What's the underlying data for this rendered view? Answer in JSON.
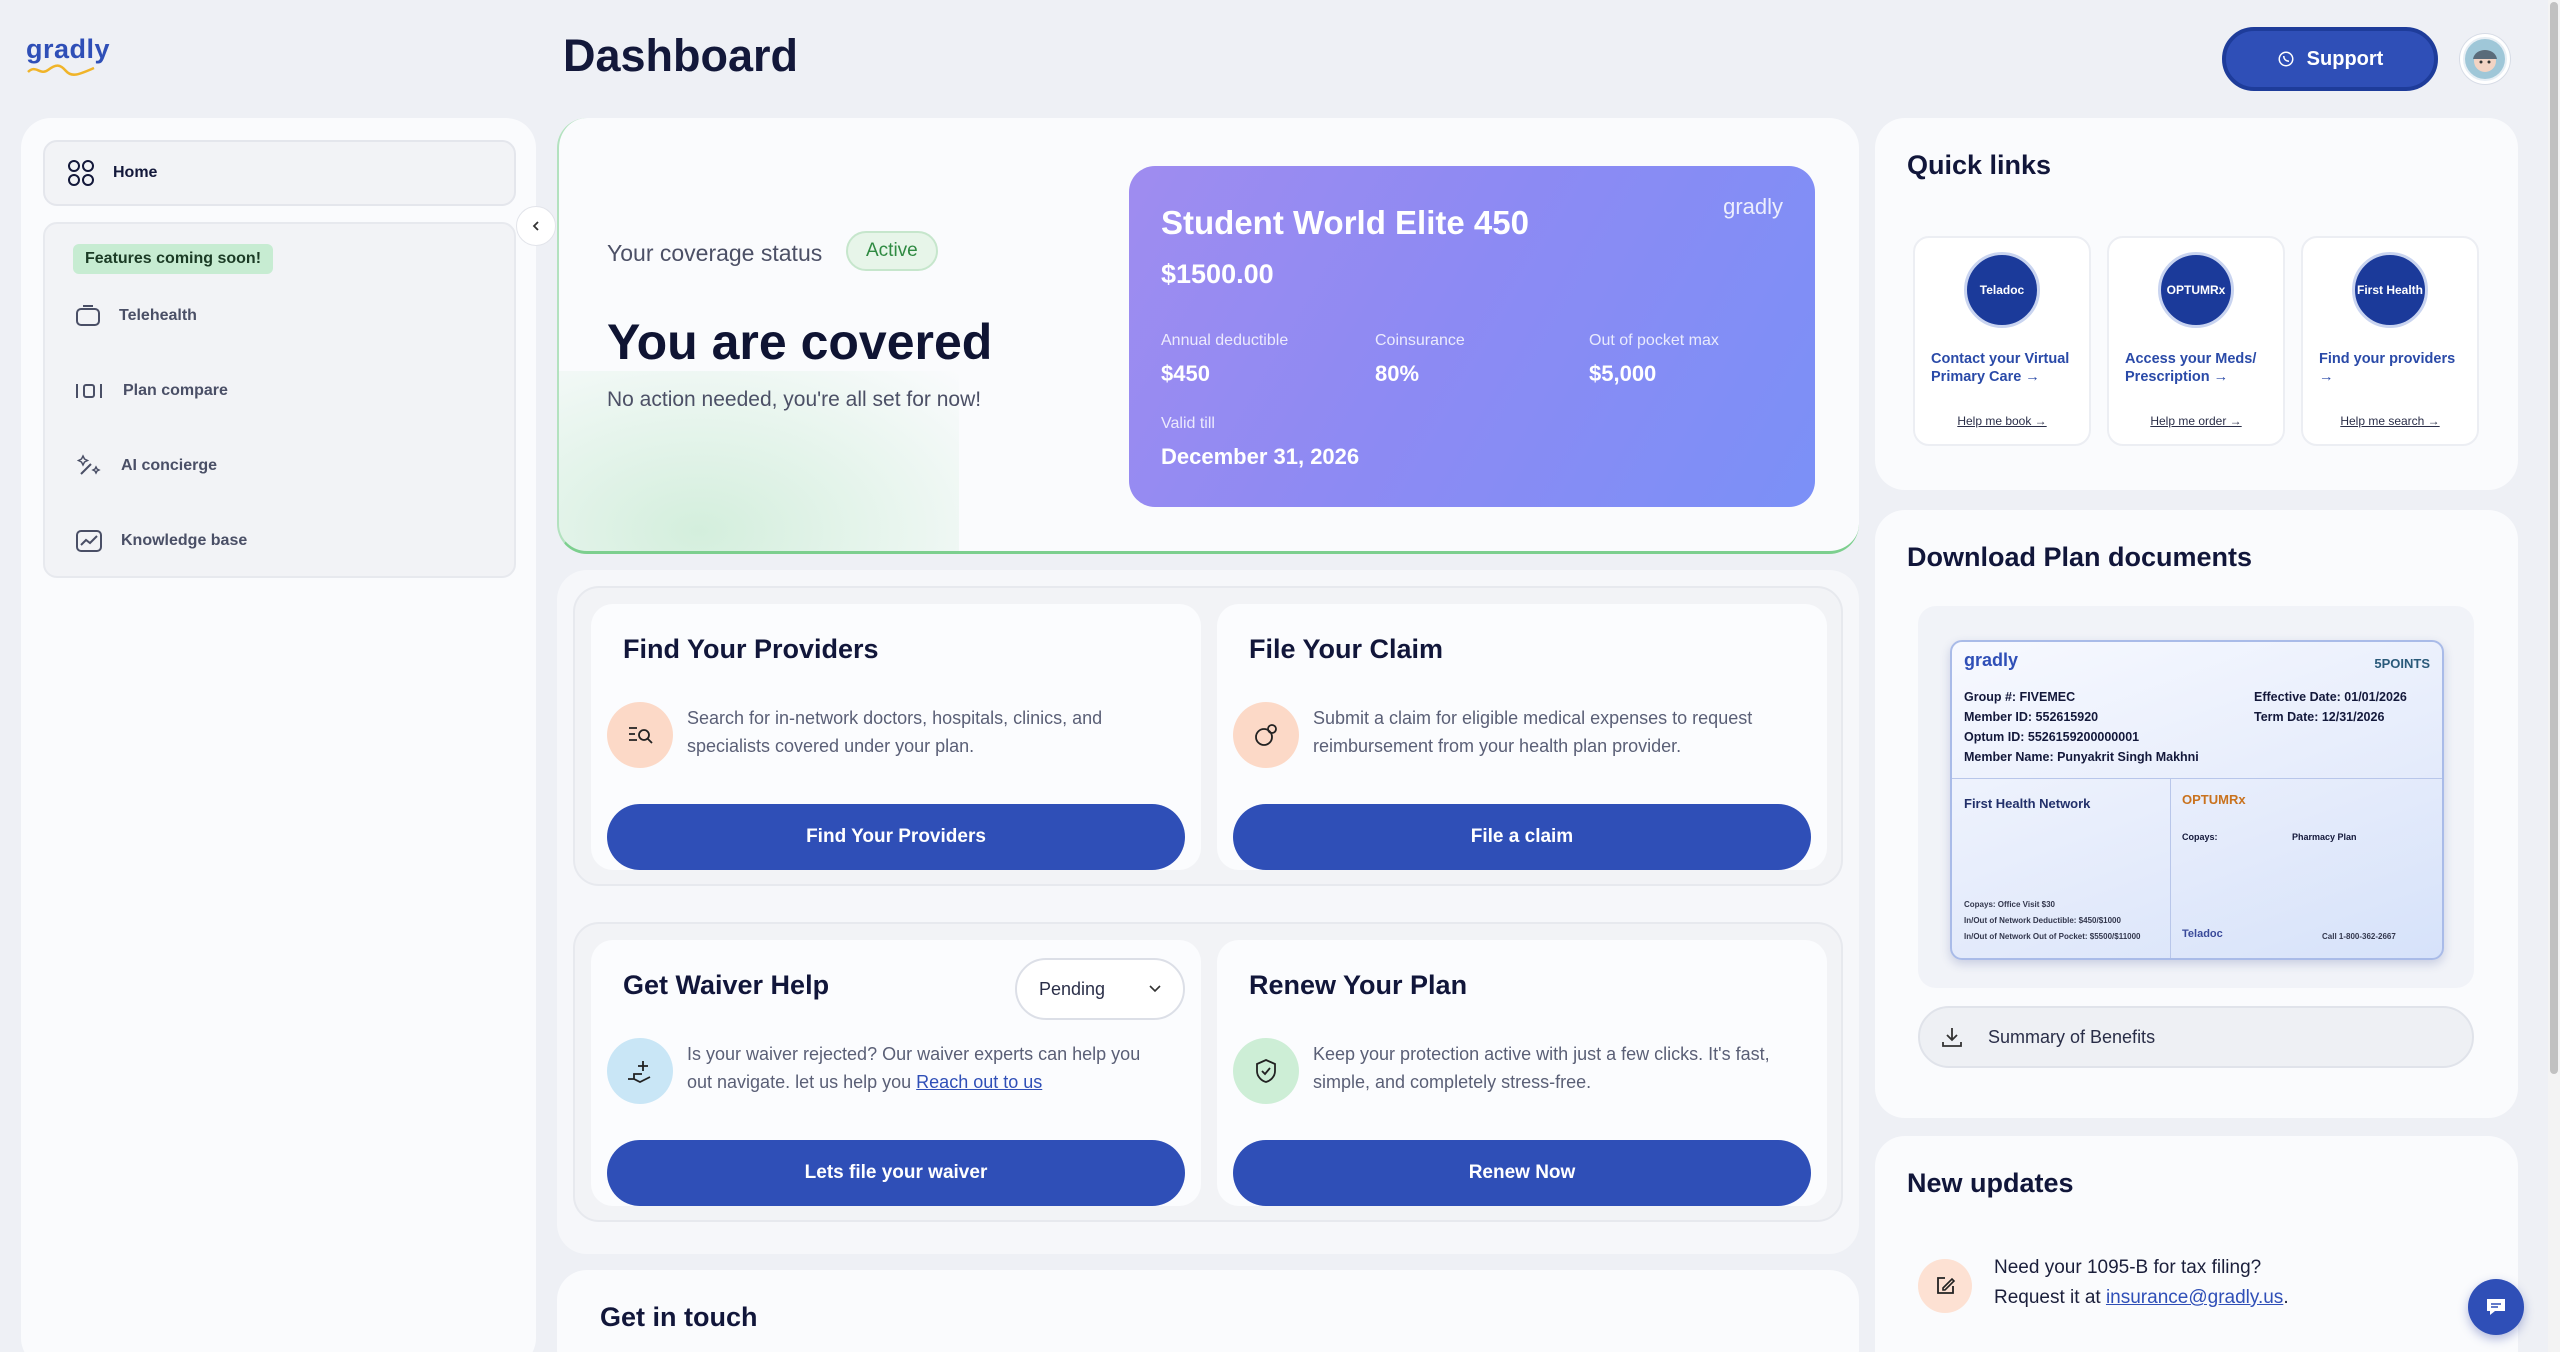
{
  "app": {
    "logo": "gradly",
    "title": "Dashboard"
  },
  "header": {
    "support_label": "Support"
  },
  "sidebar": {
    "home_label": "Home",
    "soon_badge": "Features coming soon!",
    "items": [
      {
        "label": "Telehealth",
        "icon": "tv-icon"
      },
      {
        "label": "Plan compare",
        "icon": "compare-icon"
      },
      {
        "label": "AI concierge",
        "icon": "sparkle-icon"
      },
      {
        "label": "Knowledge base",
        "icon": "chart-icon"
      }
    ]
  },
  "coverage": {
    "status_label": "Your coverage status",
    "status": "Active",
    "headline": "You are covered",
    "subtext": "No action needed, you're all set for now!",
    "plan": {
      "logo": "gradly",
      "name": "Student World Elite 450",
      "price": "$1500.00",
      "deductible_label": "Annual deductible",
      "deductible": "$450",
      "coinsurance_label": "Coinsurance",
      "coinsurance": "80%",
      "oop_label": "Out of pocket max",
      "oop": "$5,000",
      "valid_label": "Valid till",
      "valid": "December 31, 2026"
    }
  },
  "tiles": {
    "providers": {
      "title": "Find Your Providers",
      "desc": "Search for in-network doctors, hospitals, clinics, and specialists covered under your plan.",
      "button": "Find Your Providers"
    },
    "claim": {
      "title": "File Your Claim",
      "desc": "Submit a claim for eligible medical expenses to request reimbursement from your health plan provider.",
      "button": "File a claim"
    },
    "waiver": {
      "title": "Get Waiver Help",
      "status": "Pending",
      "desc": "Is your waiver rejected? Our waiver experts can help you out navigate. let us help you",
      "link": "Reach out to us",
      "button": "Lets file your waiver"
    },
    "renew": {
      "title": "Renew Your Plan",
      "desc": "Keep your protection active with just a few clicks. It's fast, simple, and completely stress-free.",
      "button": "Renew Now"
    }
  },
  "get_in_touch": {
    "title": "Get in touch"
  },
  "quick_links": {
    "title": "Quick links",
    "items": [
      {
        "logo": "Teladoc",
        "text": "Contact your Virtual Primary Care →",
        "link": "Help me book →"
      },
      {
        "logo": "OPTUMRx",
        "text": "Access your Meds/ Prescription →",
        "link": "Help me order →"
      },
      {
        "logo": "First Health",
        "text": "Find your providers →",
        "link": "Help me search →"
      }
    ]
  },
  "documents": {
    "title": "Download Plan documents",
    "card": {
      "logo": "gradly",
      "partner": "5POINTS",
      "group": "Group #: FIVEMEC",
      "member_id": "Member ID: 552615920",
      "optum_id": "Optum ID: 5526159200000001",
      "member_name": "Member Name: Punyakrit Singh Makhni",
      "effective": "Effective Date: 01/01/2026",
      "term": "Term Date: 12/31/2026",
      "network": "First Health Network",
      "rx": "OPTUMRx",
      "copays": "Copays:",
      "pharmacy": "Pharmacy Plan",
      "office_visit": "Copays: Office Visit $30",
      "deductible": "In/Out of Network Deductible: $450/$1000",
      "oop": "In/Out of Network Out of Pocket: $5500/$11000",
      "teladoc": "Teladoc",
      "teladoc_call": "Call 1-800-362-2667"
    },
    "summary_label": "Summary of Benefits"
  },
  "updates": {
    "title": "New updates",
    "line1": "Need your 1095-B for tax filing?",
    "line2_prefix": "Request it at",
    "email": "insurance@gradly.us",
    "line2_suffix": "."
  },
  "colors": {
    "primary": "#2f4fb7",
    "active": "#2f8a42",
    "plan_gradient_start": "#9f8cf0",
    "plan_gradient_end": "#7b90f7"
  }
}
